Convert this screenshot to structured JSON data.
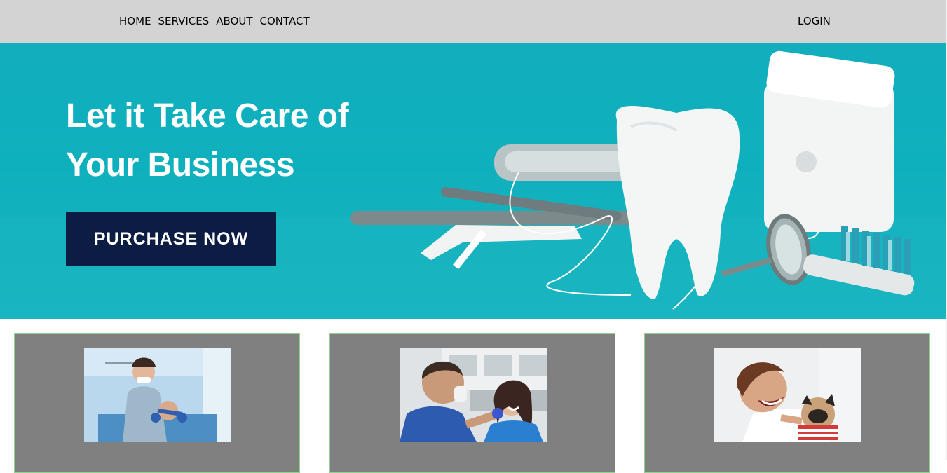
{
  "nav": {
    "links": [
      "HOME",
      "SERVICES",
      "ABOUT",
      "CONTACT"
    ],
    "login": "LOGIN",
    "background": "#d3d3d3"
  },
  "hero": {
    "title_line1": "Let it Take Care of",
    "title_line2": "Your Business",
    "button_label": "PURCHASE NOW",
    "background": "#12aebd",
    "button_color": "#0c1c42"
  },
  "cards": [
    {
      "image": "dentist-treating-patient-photo",
      "title": ""
    },
    {
      "image": "dentist-with-smiling-patient-photo",
      "title": ""
    },
    {
      "image": "laughing-boy-with-puppy-photo",
      "title": ""
    }
  ],
  "colors": {
    "card_background": "#808080",
    "card_border": "#90d090"
  }
}
